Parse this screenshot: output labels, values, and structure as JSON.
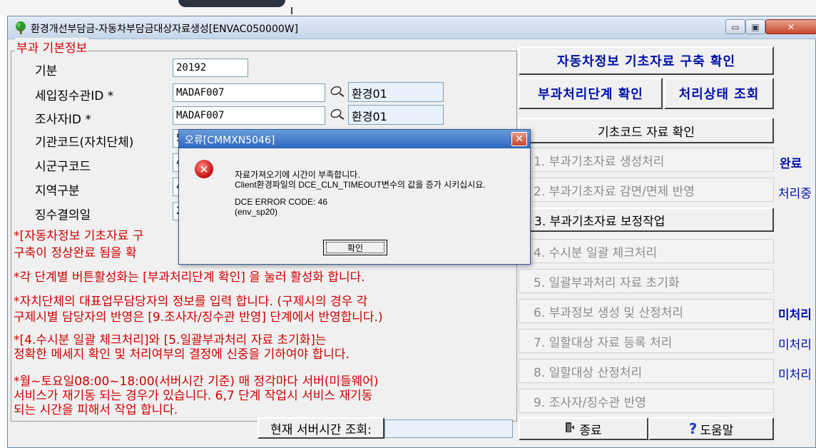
{
  "window": {
    "title": "환경개선부담금-자동차부담금대상자료생성[ENVAC050000W]",
    "min_glyph": "▭",
    "max_glyph": "▣",
    "close_glyph": "✕"
  },
  "form": {
    "group_title": "부과 기본정보",
    "fields": {
      "period": {
        "label": "기분",
        "value": "20192"
      },
      "collector_id": {
        "label": "세입징수관ID  *",
        "value": "MADAF007",
        "name": "환경01"
      },
      "inspector_id": {
        "label": "조사자ID  *",
        "value": "MADAF007",
        "name": "환경01"
      },
      "agency_code": {
        "label": "기관코드(자치단체)",
        "value": "5"
      },
      "district_code": {
        "label": "시군구코드",
        "value": "4"
      },
      "region_type": {
        "label": "지역구분",
        "value": "4"
      },
      "collection_date": {
        "label": "징수결의일",
        "value": "2"
      }
    },
    "notes": [
      "*[자동차정보 기초자료 구",
      "  구축이 정상완료 됨을 확",
      "*각 단계별 버튼활성화는 [부과처리단계 확인] 을 눌러 활성화 합니다.",
      "*자치단체의 대표업무담당자의 정보를 입력 합니다. (구제시의 경우 각",
      "  구제시별 담당자의 반영은 [9.조사자/징수관 반영] 단계에서 반영합니다.)",
      "*[4.수시분 일괄 체크처리]와 [5.일괄부과처리 자료 초기화]는",
      "  정확한 메세지 확인 및 처리여부의 결정에 신중을 기하여야 합니다.",
      "*월~토요일08:00~18:00(서버시간 기준) 매 정각마다 서버(미들웨어)",
      "  서비스가 재기동 되는 경우가 있습니다. 6,7 단계 작업시 서비스 재기동",
      "  되는 시간을 피해서 작업 합니다."
    ],
    "server_time_label": "현재 서버시간 조회:",
    "server_time_value": ""
  },
  "actions": {
    "build_check": "자동차정보 기초자료 구축 확인",
    "stage_check": "부과처리단계 확인",
    "status_query": "처리상태 조회",
    "code_check": "기초코드 자료 확인",
    "steps": [
      {
        "label": "1. 부과기초자료 생성처리",
        "status": "완료"
      },
      {
        "label": "2. 부과기초자료 감면/면제 반영",
        "status": "처리중"
      },
      {
        "label": "3. 부과기초자료 보정작업",
        "status": ""
      },
      {
        "label": "4. 수시분 일괄 체크처리",
        "status": ""
      },
      {
        "label": "5. 일괄부과처리 자료 초기화",
        "status": ""
      },
      {
        "label": "6. 부과정보 생성 및 산정처리",
        "status": "미처리"
      },
      {
        "label": "7. 일할대상 자료 등록 처리",
        "status": "미처리"
      },
      {
        "label": "8. 일할대상 산정처리",
        "status": "미처리"
      },
      {
        "label": "9. 조사자/징수관 반영",
        "status": ""
      }
    ],
    "exit_label": "종료",
    "help_label": "도움말"
  },
  "dialog": {
    "title": "오류[CMMXN5046]",
    "line1": "자료가져오기에 시간이 부족합니다.",
    "line2": "Client환경파일의 DCE_CLN_TIMEOUT변수의 값을 증가 시키십시요.",
    "line3": "DCE ERROR CODE: 46",
    "line4": "(env_sp20)",
    "ok_label": "확인"
  },
  "colors": {
    "accent_blue": "#0010a8",
    "note_red": "#d00000",
    "dialog_title": "#2c67bf"
  },
  "icons": {
    "app": "tree-icon",
    "lookup": "magnifier-icon",
    "error": "error-icon",
    "exit": "exit-door-icon",
    "help": "question-icon"
  }
}
